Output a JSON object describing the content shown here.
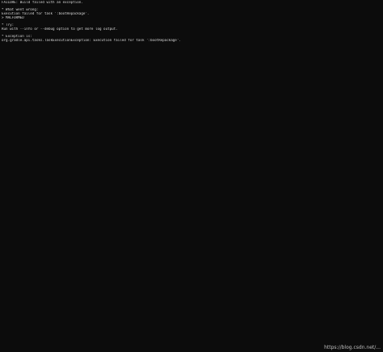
{
  "terminal": {
    "lines": [
      "FAILURE: Build failed with an exception.",
      "",
      "* What went wrong:",
      "Execution failed for task ':bootRepackage'.",
      "> MALFORMED",
      "",
      "* Try:",
      "Run with --info or --debug option to get more log output.",
      "",
      "* Exception is:",
      "org.gradle.api.tasks.TaskExecutionException: Execution failed for task ':bootRepackage'."
    ],
    "watermark": "https://blog.csdn.net/..."
  },
  "colors": {
    "background": "#0c0c0c",
    "text": "#d8d8d8"
  }
}
